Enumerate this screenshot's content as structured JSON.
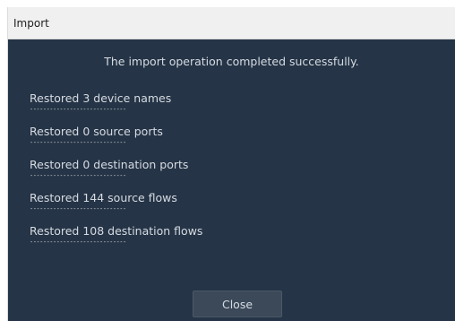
{
  "dialog": {
    "title": "Import",
    "message": "The import operation completed successfully.",
    "results": [
      "Restored 3 device names",
      "Restored 0 source ports",
      "Restored 0 destination ports",
      "Restored 144 source flows",
      "Restored 108 destination flows"
    ],
    "separator": "-----------------------------",
    "close_label": "Close"
  },
  "colors": {
    "background": "#253446",
    "titlebar": "#f0f0f0",
    "text": "#d6dbe2",
    "button": "#3b4959"
  }
}
